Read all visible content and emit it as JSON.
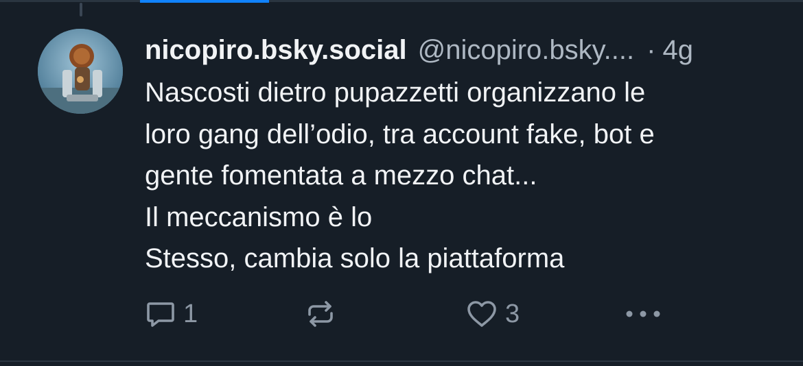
{
  "post": {
    "author": {
      "display_name": "nicopiro.bsky.social",
      "handle": "@nicopiro.bsky...."
    },
    "separator": "·",
    "timestamp": "4g",
    "text_lines": [
      "Nascosti dietro pupazzetti organizzano le",
      "loro gang dell’odio, tra account fake, bot e",
      "gente fomentata a mezzo chat...",
      "Il meccanismo è lo",
      "Stesso, cambia solo la piattaforma"
    ],
    "actions": {
      "reply_count": "1",
      "like_count": "3",
      "reply_icon": "speech-bubble-icon",
      "repost_icon": "repost-arrows-icon",
      "like_icon": "heart-icon",
      "more_icon": "ellipsis-icon"
    }
  },
  "colors": {
    "background": "#161e27",
    "text_primary": "#f1f3f5",
    "text_secondary": "#aeb8c3",
    "icon": "#8d98a5",
    "accent": "#1083fe"
  }
}
